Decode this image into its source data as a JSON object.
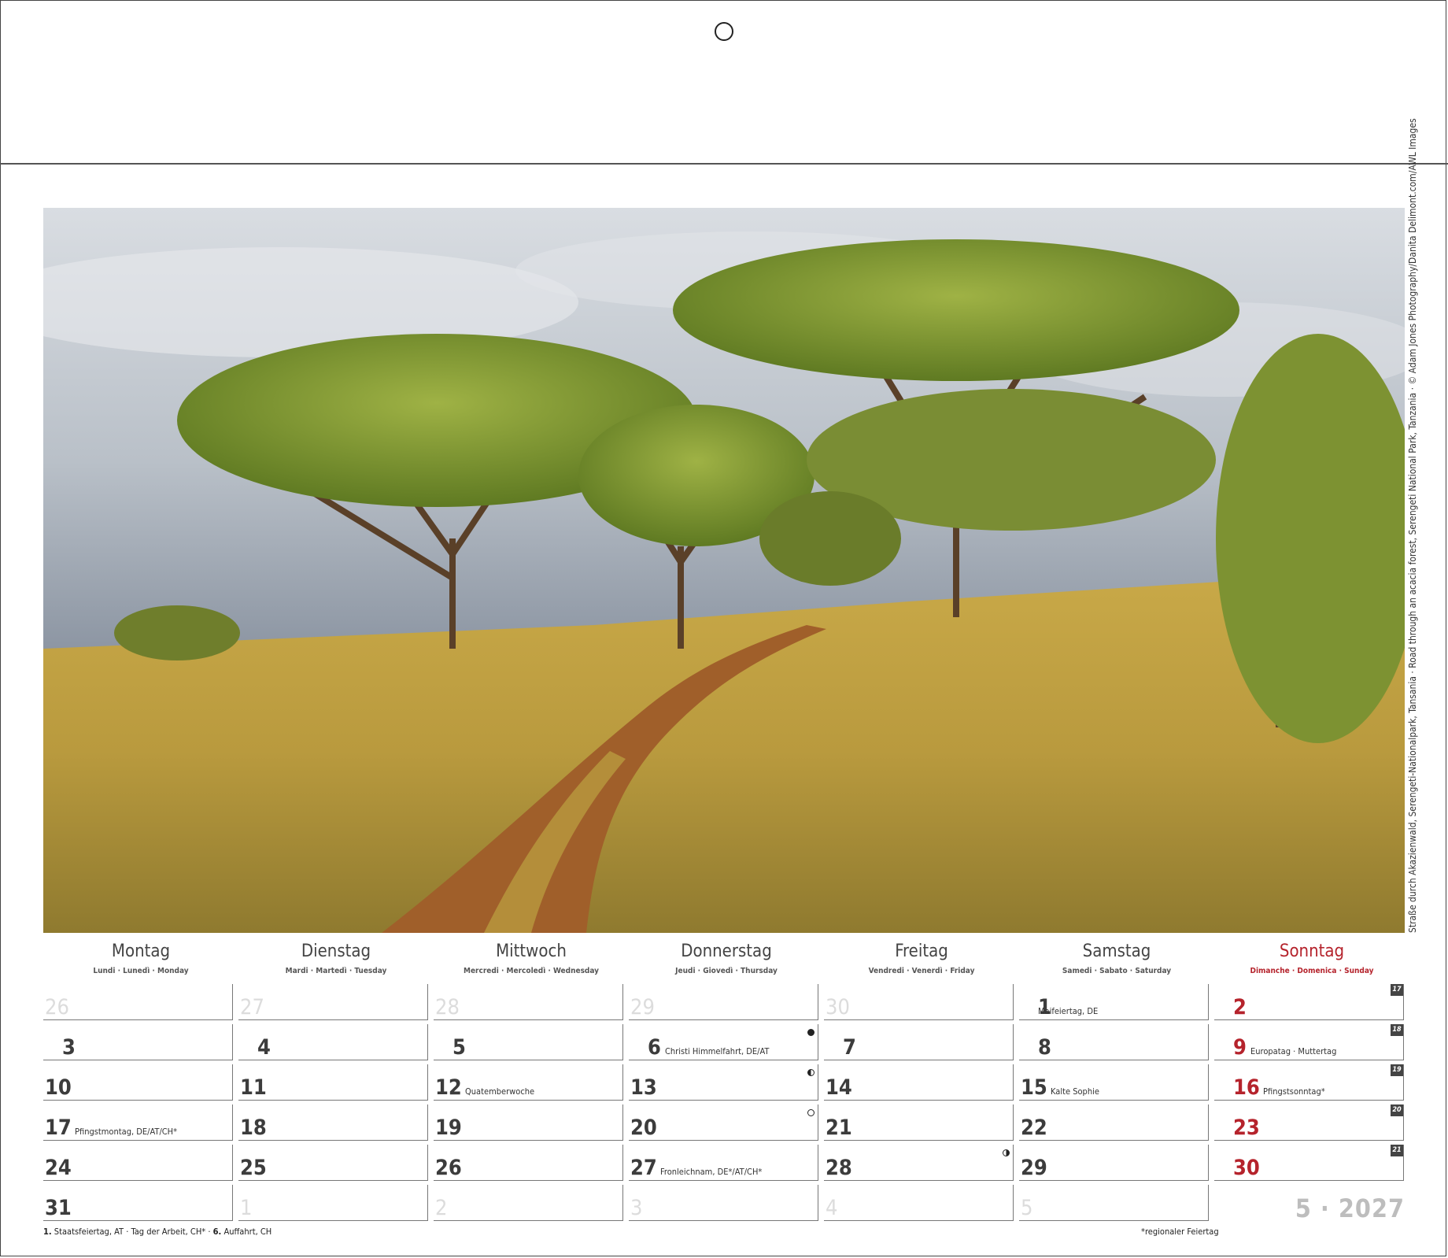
{
  "photo": {
    "credit": "Straße durch Akazienwald, Serengeti-Nationalpark, Tansania · Road through an acacia forest, Serengeti National Park, Tanzania · © Adam Jones Photography/Danita Delimont.com/AWL Images"
  },
  "weekdays": [
    {
      "name": "Montag",
      "sub": "Lundi · Lunedì · Monday"
    },
    {
      "name": "Dienstag",
      "sub": "Mardi · Martedì · Tuesday"
    },
    {
      "name": "Mittwoch",
      "sub": "Mercredi · Mercoledì · Wednesday"
    },
    {
      "name": "Donnerstag",
      "sub": "Jeudi · Giovedì · Thursday"
    },
    {
      "name": "Freitag",
      "sub": "Vendredi · Venerdì · Friday"
    },
    {
      "name": "Samstag",
      "sub": "Samedi · Sabato · Saturday"
    },
    {
      "name": "Sonntag",
      "sub": "Dimanche · Domenica · Sunday"
    }
  ],
  "weeks": [
    {
      "kw": "17",
      "days": [
        {
          "n": "26",
          "faded": true
        },
        {
          "n": "27",
          "faded": true
        },
        {
          "n": "28",
          "faded": true
        },
        {
          "n": "29",
          "faded": true
        },
        {
          "n": "30",
          "faded": true
        },
        {
          "n": "1",
          "note": "Maifeiertag, DE"
        },
        {
          "n": "2"
        }
      ]
    },
    {
      "kw": "18",
      "days": [
        {
          "n": "3"
        },
        {
          "n": "4"
        },
        {
          "n": "5"
        },
        {
          "n": "6",
          "note": "Christi Himmelfahrt, DE/AT",
          "moon": "new"
        },
        {
          "n": "7"
        },
        {
          "n": "8"
        },
        {
          "n": "9",
          "note": "Europatag · Muttertag"
        }
      ]
    },
    {
      "kw": "19",
      "days": [
        {
          "n": "10"
        },
        {
          "n": "11"
        },
        {
          "n": "12",
          "note": "Quatemberwoche"
        },
        {
          "n": "13",
          "moon": "first"
        },
        {
          "n": "14"
        },
        {
          "n": "15",
          "note": "Kalte Sophie"
        },
        {
          "n": "16",
          "note": "Pfingstsonntag*"
        }
      ]
    },
    {
      "kw": "20",
      "days": [
        {
          "n": "17",
          "note": "Pfingstmontag, DE/AT/CH*"
        },
        {
          "n": "18"
        },
        {
          "n": "19"
        },
        {
          "n": "20",
          "moon": "full"
        },
        {
          "n": "21"
        },
        {
          "n": "22"
        },
        {
          "n": "23"
        }
      ]
    },
    {
      "kw": "21",
      "days": [
        {
          "n": "24"
        },
        {
          "n": "25"
        },
        {
          "n": "26"
        },
        {
          "n": "27",
          "note": "Fronleichnam, DE*/AT/CH*"
        },
        {
          "n": "28",
          "moon": "last"
        },
        {
          "n": "29"
        },
        {
          "n": "30"
        }
      ]
    },
    {
      "kw": "",
      "days": [
        {
          "n": "31"
        },
        {
          "n": "1",
          "faded": true
        },
        {
          "n": "2",
          "faded": true
        },
        {
          "n": "3",
          "faded": true
        },
        {
          "n": "4",
          "faded": true
        },
        {
          "n": "5",
          "faded": true
        }
      ]
    }
  ],
  "footer": {
    "holidays_1_num": "1.",
    "holidays_1_text": " Staatsfeiertag, AT  ·  Tag der Arbeit, CH*  ·  ",
    "holidays_6_num": "6.",
    "holidays_6_text": " Auffahrt, CH",
    "regional_note": "*regionaler Feiertag"
  },
  "month_label": "5 · 2027",
  "colors": {
    "sunday": "#b5232c",
    "text": "#3c3c3c",
    "faded": "#dcdcdc"
  }
}
